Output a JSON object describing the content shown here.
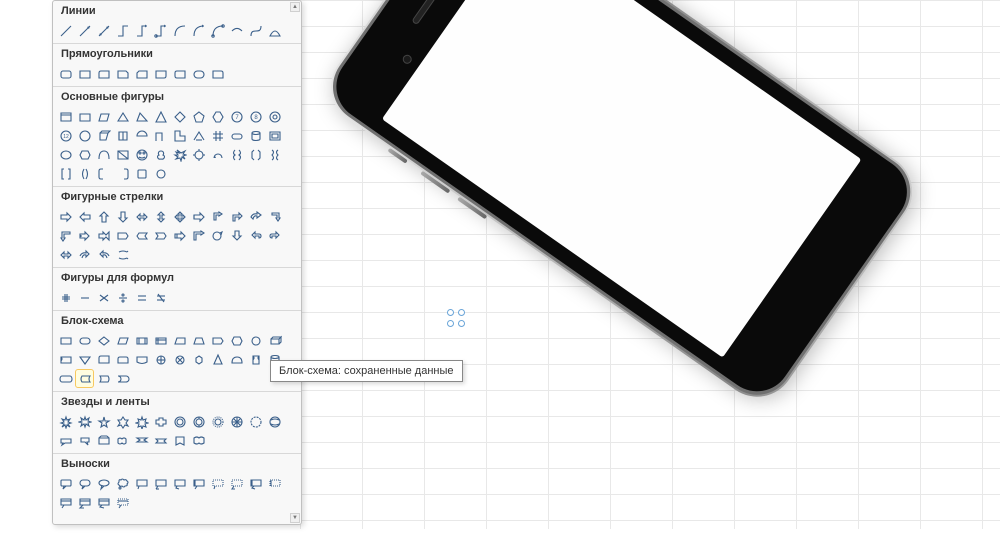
{
  "tooltip": "Блок-схема: сохраненные данные",
  "categories": [
    {
      "id": "lines",
      "label": "Линии",
      "count": 12
    },
    {
      "id": "rects",
      "label": "Прямоугольники",
      "count": 9
    },
    {
      "id": "basic",
      "label": "Основные фигуры",
      "count": 42
    },
    {
      "id": "arrows",
      "label": "Фигурные стрелки",
      "count": 28
    },
    {
      "id": "formula",
      "label": "Фигуры для формул",
      "count": 6
    },
    {
      "id": "flow",
      "label": "Блок-схема",
      "count": 28
    },
    {
      "id": "stars",
      "label": "Звезды и ленты",
      "count": 20
    },
    {
      "id": "callouts",
      "label": "Выноски",
      "count": 16
    }
  ],
  "highlighted_shape": {
    "category": "flow",
    "index": 25,
    "name": "stored-data-shape"
  },
  "colors": {
    "shape_stroke": "#3a5f8a",
    "grid": "#e8e8e8",
    "panel_bg": "#f8f8f8"
  }
}
